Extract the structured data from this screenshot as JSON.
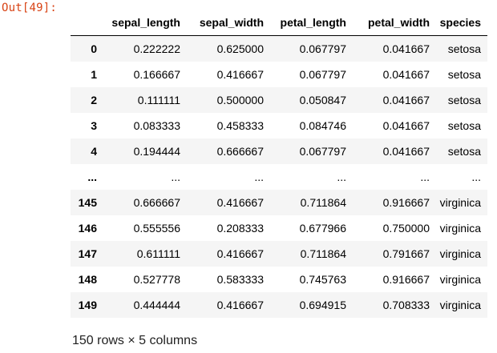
{
  "prompt": {
    "label": "Out[49]:"
  },
  "dataframe": {
    "columns": [
      "sepal_length",
      "sepal_width",
      "petal_length",
      "petal_width",
      "species"
    ],
    "rows": [
      {
        "index": "0",
        "values": [
          "0.222222",
          "0.625000",
          "0.067797",
          "0.041667",
          "setosa"
        ]
      },
      {
        "index": "1",
        "values": [
          "0.166667",
          "0.416667",
          "0.067797",
          "0.041667",
          "setosa"
        ]
      },
      {
        "index": "2",
        "values": [
          "0.111111",
          "0.500000",
          "0.050847",
          "0.041667",
          "setosa"
        ]
      },
      {
        "index": "3",
        "values": [
          "0.083333",
          "0.458333",
          "0.084746",
          "0.041667",
          "setosa"
        ]
      },
      {
        "index": "4",
        "values": [
          "0.194444",
          "0.666667",
          "0.067797",
          "0.041667",
          "setosa"
        ]
      },
      {
        "index": "...",
        "values": [
          "...",
          "...",
          "...",
          "...",
          "..."
        ]
      },
      {
        "index": "145",
        "values": [
          "0.666667",
          "0.416667",
          "0.711864",
          "0.916667",
          "virginica"
        ]
      },
      {
        "index": "146",
        "values": [
          "0.555556",
          "0.208333",
          "0.677966",
          "0.750000",
          "virginica"
        ]
      },
      {
        "index": "147",
        "values": [
          "0.611111",
          "0.416667",
          "0.711864",
          "0.791667",
          "virginica"
        ]
      },
      {
        "index": "148",
        "values": [
          "0.527778",
          "0.583333",
          "0.745763",
          "0.916667",
          "virginica"
        ]
      },
      {
        "index": "149",
        "values": [
          "0.444444",
          "0.416667",
          "0.694915",
          "0.708333",
          "virginica"
        ]
      }
    ],
    "summary": "150 rows × 5 columns"
  },
  "colors": {
    "prompt_text": "#d84315",
    "stripe": "#f5f5f5",
    "header_rule": "#000000"
  }
}
